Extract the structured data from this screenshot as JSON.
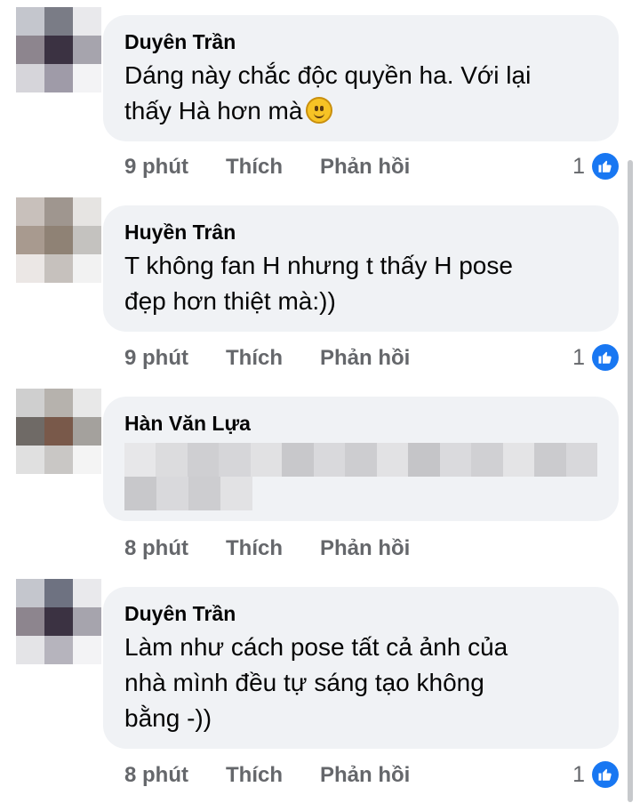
{
  "comments": [
    {
      "author": "Duyên Trần",
      "text_lines": [
        "Dáng này chắc độc quyền ha. Với lại",
        "thấy Hà hơn mà"
      ],
      "emoji": "smiling-face-emoji",
      "time": "9 phút",
      "like_label": "Thích",
      "reply_label": "Phản hồi",
      "reaction_count": "1",
      "avatar_colors": [
        "#c4c6cd",
        "#7a7c86",
        "#e9e9ec",
        "#8d858e",
        "#3b3242",
        "#a6a4ad",
        "#d6d5da",
        "#9f9ba8",
        "#f3f3f5"
      ]
    },
    {
      "author": "Huyền Trân",
      "text_lines": [
        "T không fan H nhưng t thấy H pose",
        "đẹp hơn thiệt mà:))"
      ],
      "time": "9 phút",
      "like_label": "Thích",
      "reply_label": "Phản hồi",
      "reaction_count": "1",
      "avatar_colors": [
        "#c8c0bb",
        "#9f968f",
        "#e6e4e2",
        "#a89a8f",
        "#8f8275",
        "#c4c2bf",
        "#ebe7e5",
        "#c6c1bd",
        "#f2f2f2"
      ]
    },
    {
      "author": "Hàn Văn Lựa",
      "text_lines": [],
      "time": "8 phút",
      "like_label": "Thích",
      "reply_label": "Phản hồi",
      "reaction_count": "",
      "avatar_colors": [
        "#cfcfcf",
        "#b6b2ad",
        "#e8e8e8",
        "#6f6a66",
        "#79594a",
        "#a4a19d",
        "#e0e0e0",
        "#c9c7c5",
        "#f4f4f4"
      ]
    },
    {
      "author": "Duyên Trần",
      "text_lines": [
        "Làm như cách pose tất cả ảnh của",
        "nhà mình đều tự sáng tạo không",
        "bằng -))"
      ],
      "time": "8 phút",
      "like_label": "Thích",
      "reply_label": "Phản hồi",
      "reaction_count": "1",
      "avatar_colors": [
        "#c4c6cd",
        "#6e7281",
        "#e9e9ec",
        "#8d858e",
        "#3b3242",
        "#a6a4ad",
        "#e4e4e7",
        "#b6b4bd",
        "#f3f3f5"
      ]
    }
  ],
  "colors": {
    "bubble": "#f0f2f5",
    "meta": "#65676b",
    "like_blue": "#1877f2"
  }
}
